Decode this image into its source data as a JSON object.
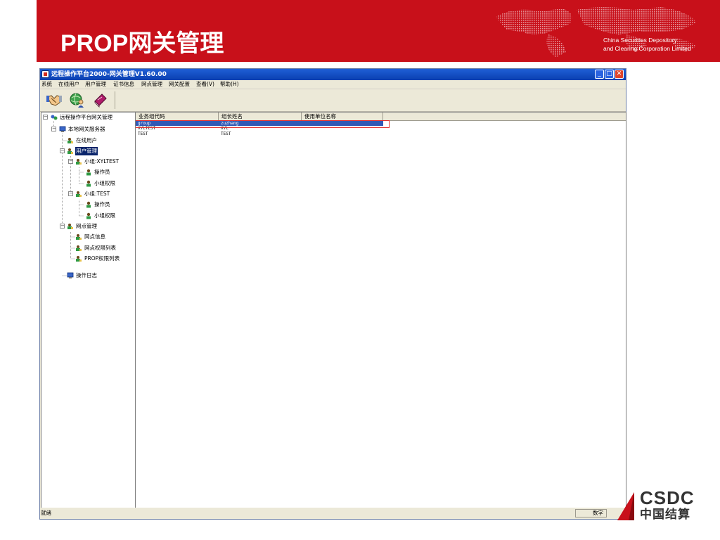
{
  "slide": {
    "title": "PROP网关管理",
    "org_line1": "China Securities Depository",
    "org_line2": "and Clearing Corporation Limited",
    "logo_en": "CSDC",
    "logo_cn": "中国结算"
  },
  "window": {
    "title": "远程操作平台2000-网关管理V1.60.00",
    "buttons": {
      "minimize": "_",
      "maximize": "□",
      "close": "✕"
    }
  },
  "menu": [
    "系统",
    "在线用户",
    "用户管理",
    "证书信息",
    "网点管理",
    "网关配置",
    "查看(V)",
    "帮助(H)"
  ],
  "toolbar": {
    "icons": [
      "handshake-icon",
      "globe-user-icon",
      "book-icon"
    ]
  },
  "tree": {
    "root": "远程操作平台网关管理",
    "server": "本地网关服务器",
    "online_users": "在线用户",
    "user_mgmt": "用户管理",
    "group1": "小组:XYLTEST",
    "g1_operator": "操作员",
    "g1_perm": "小组权限",
    "group2": "小组:TEST",
    "g2_operator": "操作员",
    "g2_perm": "小组权限",
    "node_mgmt": "网点管理",
    "node_info": "网点信息",
    "node_perm_list": "网点权限列表",
    "prop_perm_list": "PROP权限列表",
    "oplog": "操作日志"
  },
  "list": {
    "columns": [
      "业务组代码",
      "组长姓名",
      "使用单位名称"
    ],
    "rows": [
      {
        "code": "group",
        "leader": "zuzhang",
        "unit": ""
      },
      {
        "code": "XYLTEST",
        "leader": "XYL",
        "unit": ""
      },
      {
        "code": "TEST",
        "leader": "TEST",
        "unit": ""
      }
    ]
  },
  "status": {
    "text": "就绪",
    "num": "数字"
  },
  "colors": {
    "header_red": "#c8101a",
    "titlebar_blue": "#1f5fd6",
    "selection": "#0a246a",
    "highlight_box": "#e23030"
  }
}
